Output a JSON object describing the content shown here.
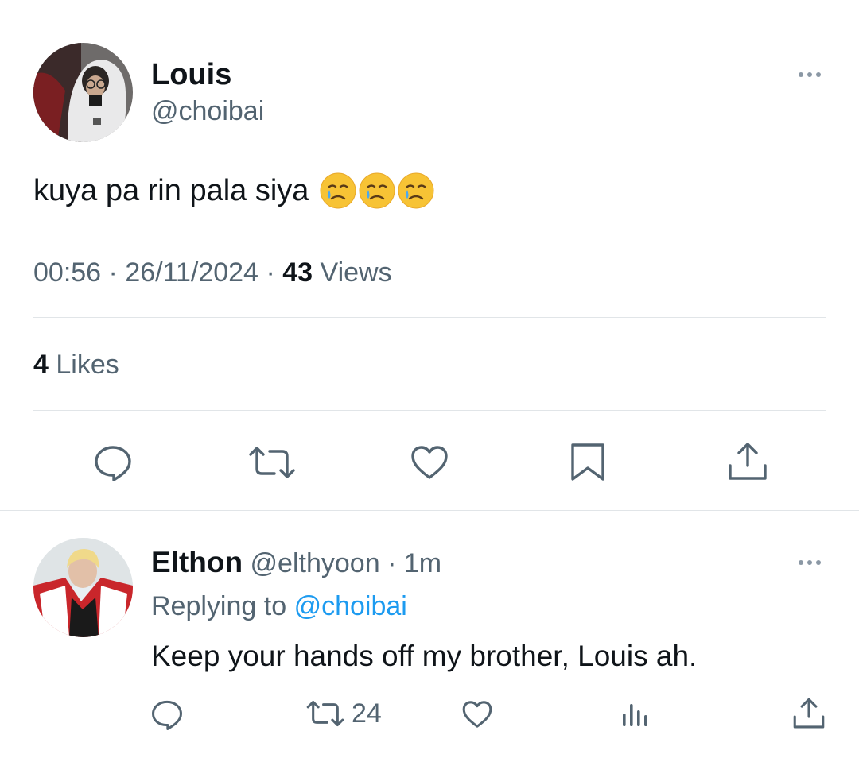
{
  "tweet": {
    "author_name": "Louis",
    "author_handle": "@choibai",
    "text": "kuya pa rin pala siya",
    "emojis": [
      "crying-face-emoji",
      "crying-face-emoji",
      "crying-face-emoji"
    ],
    "time": "00:56",
    "separator": "·",
    "date": "26/11/2024",
    "views_count": "43",
    "views_label": "Views",
    "likes_count": "4",
    "likes_label": "Likes",
    "actions": [
      "reply-icon",
      "retweet-icon",
      "like-icon",
      "bookmark-icon",
      "share-icon"
    ]
  },
  "reply": {
    "author_name": "Elthon",
    "author_handle": "@elthyoon",
    "separator": "·",
    "time": "1m",
    "replying_to_label": "Replying to",
    "replying_to_handle": "@choibai",
    "text": "Keep your hands off my brother, Louis ah.",
    "retweet_count": "24",
    "actions": [
      "reply-icon",
      "retweet-icon",
      "like-icon",
      "analytics-icon",
      "share-icon"
    ]
  },
  "colors": {
    "text_primary": "#0f1419",
    "text_secondary": "#536471",
    "link": "#1d9bf0",
    "divider": "#e1e5e8"
  }
}
